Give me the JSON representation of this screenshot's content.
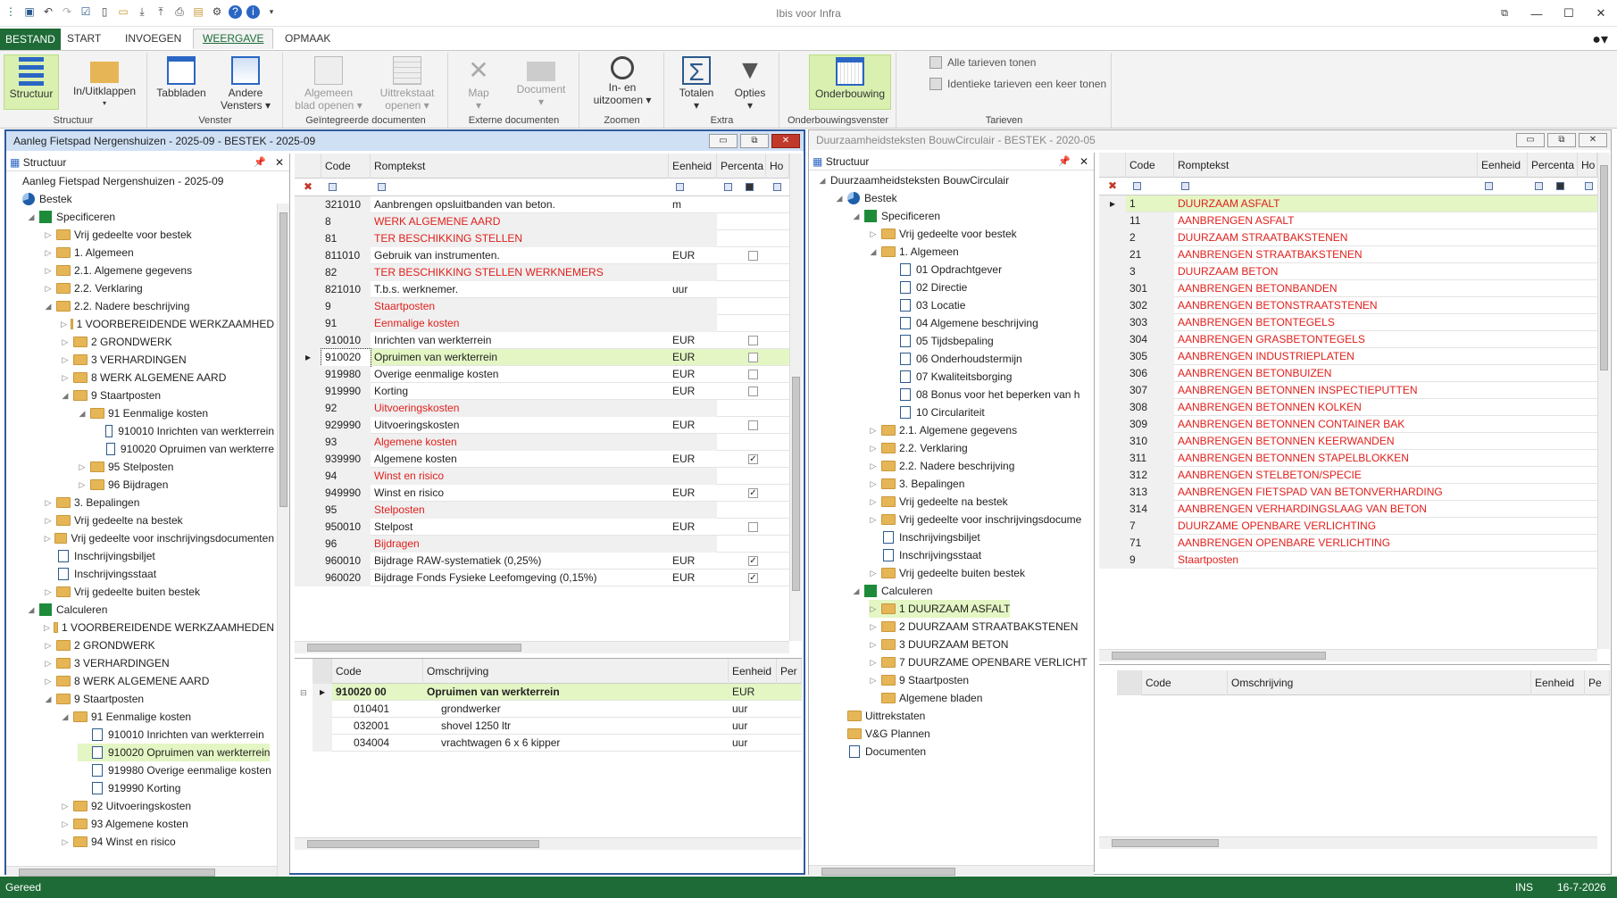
{
  "app": {
    "title": "Ibis voor Infra"
  },
  "ribbon_tabs": [
    "BESTAND",
    "START",
    "INVOEGEN",
    "WEERGAVE",
    "OPMAAK"
  ],
  "ribbon": {
    "structuur": "Structuur",
    "inuitklappen": "In/Uitklappen",
    "tabbladen": "Tabbladen",
    "andere1": "Andere",
    "andere2": "Vensters",
    "alg1": "Algemeen",
    "alg2": "blad openen",
    "uit1": "Uittrekstaat",
    "uit2": "openen",
    "map": "Map",
    "document": "Document",
    "zoom1": "In- en",
    "zoom2": "uitzoomen",
    "totalen": "Totalen",
    "opties": "Opties",
    "onderbouwing": "Onderbouwing",
    "alle": "Alle tarieven tonen",
    "identiek": "Identieke tarieven een keer tonen",
    "groups": {
      "structuur": "Structuur",
      "venster": "Venster",
      "geint": "Geïntegreerde documenten",
      "extern": "Externe documenten",
      "zoomen": "Zoomen",
      "extra": "Extra",
      "ondervenster": "Onderbouwingsvenster",
      "tarieven": "Tarieven"
    }
  },
  "left_pane": {
    "title": "Aanleg Fietspad Nergenshuizen - 2025-09 - BESTEK - 2025-09",
    "tree_header": "Structuur",
    "tree": [
      {
        "l": 0,
        "t": "Aanleg Fietspad Nergenshuizen - 2025-09",
        "i": "none",
        "tog": ""
      },
      {
        "l": 0,
        "t": "Bestek",
        "i": "pie",
        "tog": ""
      },
      {
        "l": 1,
        "t": "Specificeren",
        "i": "grn",
        "tog": "◢"
      },
      {
        "l": 2,
        "t": "Vrij gedeelte voor bestek",
        "i": "fold",
        "tog": "▷"
      },
      {
        "l": 2,
        "t": "1. Algemeen",
        "i": "fold",
        "tog": "▷"
      },
      {
        "l": 2,
        "t": "2.1. Algemene gegevens",
        "i": "fold",
        "tog": "▷"
      },
      {
        "l": 2,
        "t": "2.2. Verklaring",
        "i": "fold",
        "tog": "▷"
      },
      {
        "l": 2,
        "t": "2.2. Nadere beschrijving",
        "i": "fold",
        "tog": "◢"
      },
      {
        "l": 3,
        "t": "1   VOORBEREIDENDE WERKZAAMHED",
        "i": "fold",
        "tog": "▷"
      },
      {
        "l": 3,
        "t": "2   GRONDWERK",
        "i": "fold",
        "tog": "▷"
      },
      {
        "l": 3,
        "t": "3   VERHARDINGEN",
        "i": "fold",
        "tog": "▷"
      },
      {
        "l": 3,
        "t": "8   WERK ALGEMENE AARD",
        "i": "fold",
        "tog": "▷"
      },
      {
        "l": 3,
        "t": "9   Staartposten",
        "i": "fold",
        "tog": "◢"
      },
      {
        "l": 4,
        "t": "91   Eenmalige kosten",
        "i": "fold",
        "tog": "◢"
      },
      {
        "l": 5,
        "t": "910010   Inrichten van werkterrein",
        "i": "doc",
        "tog": ""
      },
      {
        "l": 5,
        "t": "910020   Opruimen van werkterre",
        "i": "doc",
        "tog": ""
      },
      {
        "l": 4,
        "t": "95   Stelposten",
        "i": "fold",
        "tog": "▷"
      },
      {
        "l": 4,
        "t": "96   Bijdragen",
        "i": "fold",
        "tog": "▷"
      },
      {
        "l": 2,
        "t": "3. Bepalingen",
        "i": "fold",
        "tog": "▷"
      },
      {
        "l": 2,
        "t": "Vrij gedeelte na bestek",
        "i": "fold",
        "tog": "▷"
      },
      {
        "l": 2,
        "t": "Vrij gedeelte voor inschrijvingsdocumenten",
        "i": "fold",
        "tog": "▷"
      },
      {
        "l": 2,
        "t": "Inschrijvingsbiljet",
        "i": "doc",
        "tog": ""
      },
      {
        "l": 2,
        "t": "Inschrijvingsstaat",
        "i": "doc",
        "tog": ""
      },
      {
        "l": 2,
        "t": "Vrij gedeelte buiten bestek",
        "i": "fold",
        "tog": "▷"
      },
      {
        "l": 1,
        "t": "Calculeren",
        "i": "grn",
        "tog": "◢"
      },
      {
        "l": 2,
        "t": "1   VOORBEREIDENDE WERKZAAMHEDEN",
        "i": "fold",
        "tog": "▷"
      },
      {
        "l": 2,
        "t": "2   GRONDWERK",
        "i": "fold",
        "tog": "▷"
      },
      {
        "l": 2,
        "t": "3   VERHARDINGEN",
        "i": "fold",
        "tog": "▷"
      },
      {
        "l": 2,
        "t": "8   WERK ALGEMENE AARD",
        "i": "fold",
        "tog": "▷"
      },
      {
        "l": 2,
        "t": "9   Staartposten",
        "i": "fold",
        "tog": "◢"
      },
      {
        "l": 3,
        "t": "91   Eenmalige kosten",
        "i": "fold",
        "tog": "◢"
      },
      {
        "l": 4,
        "t": "910010   Inrichten van werkterrein",
        "i": "doc",
        "tog": ""
      },
      {
        "l": 4,
        "t": "910020   Opruimen van werkterrein",
        "i": "doc",
        "tog": "",
        "sel": true
      },
      {
        "l": 4,
        "t": "919980   Overige eenmalige kosten",
        "i": "doc",
        "tog": ""
      },
      {
        "l": 4,
        "t": "919990   Korting",
        "i": "doc",
        "tog": ""
      },
      {
        "l": 3,
        "t": "92   Uitvoeringskosten",
        "i": "fold",
        "tog": "▷"
      },
      {
        "l": 3,
        "t": "93   Algemene kosten",
        "i": "fold",
        "tog": "▷"
      },
      {
        "l": 3,
        "t": "94   Winst en risico",
        "i": "fold",
        "tog": "▷"
      }
    ],
    "grid_headers": [
      "Code",
      "Romptekst",
      "Eenheid",
      "Percenta",
      "Ho"
    ],
    "grid": [
      {
        "c": "321010",
        "t": "Aanbrengen opsluitbanden van beton.",
        "e": "m",
        "cb": "",
        "red": false,
        "gray": false
      },
      {
        "c": "8",
        "t": "WERK ALGEMENE AARD",
        "e": "",
        "cb": "",
        "red": true,
        "gray": true
      },
      {
        "c": "81",
        "t": "TER BESCHIKKING STELLEN",
        "e": "",
        "cb": "",
        "red": true,
        "gray": true
      },
      {
        "c": "811010",
        "t": "Gebruik van instrumenten.",
        "e": "EUR",
        "cb": "o",
        "red": false,
        "gray": false
      },
      {
        "c": "82",
        "t": "TER BESCHIKKING STELLEN WERKNEMERS",
        "e": "",
        "cb": "",
        "red": true,
        "gray": true
      },
      {
        "c": "821010",
        "t": "T.b.s. werknemer.",
        "e": "uur",
        "cb": "",
        "red": false,
        "gray": false
      },
      {
        "c": "9",
        "t": "Staartposten",
        "e": "",
        "cb": "",
        "red": true,
        "gray": true
      },
      {
        "c": "91",
        "t": "Eenmalige kosten",
        "e": "",
        "cb": "",
        "red": true,
        "gray": true
      },
      {
        "c": "910010",
        "t": "Inrichten van werkterrein",
        "e": "EUR",
        "cb": "o",
        "red": false,
        "gray": false
      },
      {
        "c": "910020",
        "t": "Opruimen van werkterrein",
        "e": "EUR",
        "cb": "o",
        "red": false,
        "gray": false,
        "sel": true
      },
      {
        "c": "919980",
        "t": "Overige eenmalige kosten",
        "e": "EUR",
        "cb": "o",
        "red": false,
        "gray": false
      },
      {
        "c": "919990",
        "t": "Korting",
        "e": "EUR",
        "cb": "o",
        "red": false,
        "gray": false
      },
      {
        "c": "92",
        "t": "Uitvoeringskosten",
        "e": "",
        "cb": "",
        "red": true,
        "gray": true
      },
      {
        "c": "929990",
        "t": "Uitvoeringskosten",
        "e": "EUR",
        "cb": "o",
        "red": false,
        "gray": false
      },
      {
        "c": "93",
        "t": "Algemene kosten",
        "e": "",
        "cb": "",
        "red": true,
        "gray": true
      },
      {
        "c": "939990",
        "t": "Algemene kosten",
        "e": "EUR",
        "cb": "x",
        "red": false,
        "gray": false
      },
      {
        "c": "94",
        "t": "Winst en risico",
        "e": "",
        "cb": "",
        "red": true,
        "gray": true
      },
      {
        "c": "949990",
        "t": "Winst en risico",
        "e": "EUR",
        "cb": "x",
        "red": false,
        "gray": false
      },
      {
        "c": "95",
        "t": "Stelposten",
        "e": "",
        "cb": "",
        "red": true,
        "gray": true
      },
      {
        "c": "950010",
        "t": "Stelpost",
        "e": "EUR",
        "cb": "o",
        "red": false,
        "gray": false
      },
      {
        "c": "96",
        "t": "Bijdragen",
        "e": "",
        "cb": "",
        "red": true,
        "gray": true
      },
      {
        "c": "960010",
        "t": "Bijdrage RAW-systematiek (0,25%)",
        "e": "EUR",
        "cb": "x",
        "red": false,
        "gray": false
      },
      {
        "c": "960020",
        "t": "Bijdrage Fonds Fysieke Leefomgeving (0,15%)",
        "e": "EUR",
        "cb": "x",
        "red": false,
        "gray": false
      }
    ],
    "sub_headers": [
      "Code",
      "Omschrijving",
      "Eenheid",
      "Per"
    ],
    "sub_rows": [
      {
        "c": "910020 00",
        "t": "Opruimen van werkterrein",
        "e": "EUR",
        "bold": true
      },
      {
        "c": "010401",
        "t": "grondwerker",
        "e": "uur",
        "bold": false
      },
      {
        "c": "032001",
        "t": "shovel 1250 ltr",
        "e": "uur",
        "bold": false
      },
      {
        "c": "034004",
        "t": "vrachtwagen 6 x 6  kipper",
        "e": "uur",
        "bold": false
      }
    ]
  },
  "right_pane": {
    "title": "Duurzaamheidsteksten BouwCirculair - BESTEK - 2020-05",
    "tree_header": "Structuur",
    "tree": [
      {
        "l": 0,
        "t": "Duurzaamheidsteksten BouwCirculair",
        "i": "none",
        "tog": "◢"
      },
      {
        "l": 1,
        "t": "Bestek",
        "i": "pie",
        "tog": "◢"
      },
      {
        "l": 2,
        "t": "Specificeren",
        "i": "grn",
        "tog": "◢"
      },
      {
        "l": 3,
        "t": "Vrij gedeelte voor bestek",
        "i": "fold",
        "tog": "▷"
      },
      {
        "l": 3,
        "t": "1. Algemeen",
        "i": "fold",
        "tog": "◢"
      },
      {
        "l": 4,
        "t": "01   Opdrachtgever",
        "i": "doc",
        "tog": ""
      },
      {
        "l": 4,
        "t": "02   Directie",
        "i": "doc",
        "tog": ""
      },
      {
        "l": 4,
        "t": "03   Locatie",
        "i": "doc",
        "tog": ""
      },
      {
        "l": 4,
        "t": "04   Algemene beschrijving",
        "i": "doc",
        "tog": ""
      },
      {
        "l": 4,
        "t": "05   Tijdsbepaling",
        "i": "doc",
        "tog": ""
      },
      {
        "l": 4,
        "t": "06   Onderhoudstermijn",
        "i": "doc",
        "tog": ""
      },
      {
        "l": 4,
        "t": "07   Kwaliteitsborging",
        "i": "doc",
        "tog": ""
      },
      {
        "l": 4,
        "t": "08   Bonus voor het beperken van h",
        "i": "doc",
        "tog": ""
      },
      {
        "l": 4,
        "t": "10   Circulariteit",
        "i": "doc",
        "tog": ""
      },
      {
        "l": 3,
        "t": "2.1. Algemene gegevens",
        "i": "fold",
        "tog": "▷"
      },
      {
        "l": 3,
        "t": "2.2. Verklaring",
        "i": "fold",
        "tog": "▷"
      },
      {
        "l": 3,
        "t": "2.2. Nadere beschrijving",
        "i": "fold",
        "tog": "▷"
      },
      {
        "l": 3,
        "t": "3. Bepalingen",
        "i": "fold",
        "tog": "▷"
      },
      {
        "l": 3,
        "t": "Vrij gedeelte na bestek",
        "i": "fold",
        "tog": "▷"
      },
      {
        "l": 3,
        "t": "Vrij gedeelte voor inschrijvingsdocume",
        "i": "fold",
        "tog": "▷"
      },
      {
        "l": 3,
        "t": "Inschrijvingsbiljet",
        "i": "doc",
        "tog": ""
      },
      {
        "l": 3,
        "t": "Inschrijvingsstaat",
        "i": "doc",
        "tog": ""
      },
      {
        "l": 3,
        "t": "Vrij gedeelte buiten bestek",
        "i": "fold",
        "tog": "▷"
      },
      {
        "l": 2,
        "t": "Calculeren",
        "i": "grn",
        "tog": "◢"
      },
      {
        "l": 3,
        "t": "1   DUURZAAM ASFALT",
        "i": "fold",
        "tog": "▷",
        "sel": true
      },
      {
        "l": 3,
        "t": "2   DUURZAAM STRAATBAKSTENEN",
        "i": "fold",
        "tog": "▷"
      },
      {
        "l": 3,
        "t": "3   DUURZAAM BETON",
        "i": "fold",
        "tog": "▷"
      },
      {
        "l": 3,
        "t": "7   DUURZAME OPENBARE VERLICHT",
        "i": "fold",
        "tog": "▷"
      },
      {
        "l": 3,
        "t": "9   Staartposten",
        "i": "fold",
        "tog": "▷"
      },
      {
        "l": 3,
        "t": "Algemene bladen",
        "i": "fold",
        "tog": ""
      },
      {
        "l": 1,
        "t": "Uittrekstaten",
        "i": "fold",
        "tog": ""
      },
      {
        "l": 1,
        "t": "V&G Plannen",
        "i": "fold",
        "tog": ""
      },
      {
        "l": 1,
        "t": "Documenten",
        "i": "doc",
        "tog": ""
      }
    ],
    "grid_headers": [
      "Code",
      "Romptekst",
      "Eenheid",
      "Percenta",
      "Ho"
    ],
    "grid": [
      {
        "c": "1",
        "t": "DUURZAAM ASFALT",
        "sel": true
      },
      {
        "c": "11",
        "t": "AANBRENGEN ASFALT"
      },
      {
        "c": "2",
        "t": "DUURZAAM STRAATBAKSTENEN"
      },
      {
        "c": "21",
        "t": "AANBRENGEN STRAATBAKSTENEN"
      },
      {
        "c": "3",
        "t": "DUURZAAM BETON"
      },
      {
        "c": "301",
        "t": "AANBRENGEN BETONBANDEN"
      },
      {
        "c": "302",
        "t": "AANBRENGEN BETONSTRAATSTENEN"
      },
      {
        "c": "303",
        "t": "AANBRENGEN BETONTEGELS"
      },
      {
        "c": "304",
        "t": "AANBRENGEN GRASBETONTEGELS"
      },
      {
        "c": "305",
        "t": "AANBRENGEN INDUSTRIEPLATEN"
      },
      {
        "c": "306",
        "t": "AANBRENGEN BETONBUIZEN"
      },
      {
        "c": "307",
        "t": "AANBRENGEN BETONNEN INSPECTIEPUTTEN"
      },
      {
        "c": "308",
        "t": "AANBRENGEN BETONNEN KOLKEN"
      },
      {
        "c": "309",
        "t": "AANBRENGEN BETONNEN CONTAINER BAK"
      },
      {
        "c": "310",
        "t": "AANBRENGEN BETONNEN KEERWANDEN"
      },
      {
        "c": "311",
        "t": "AANBRENGEN BETONNEN STAPELBLOKKEN"
      },
      {
        "c": "312",
        "t": "AANBRENGEN STELBETON/SPECIE"
      },
      {
        "c": "313",
        "t": "AANBRENGEN FIETSPAD VAN BETONVERHARDING"
      },
      {
        "c": "314",
        "t": "AANBRENGEN VERHARDINGSLAAG VAN BETON"
      },
      {
        "c": "7",
        "t": "DUURZAME OPENBARE VERLICHTING"
      },
      {
        "c": "71",
        "t": "AANBRENGEN OPENBARE VERLICHTING"
      },
      {
        "c": "9",
        "t": "Staartposten"
      }
    ],
    "sub_headers": [
      "Code",
      "Omschrijving",
      "Eenheid",
      "Pe"
    ]
  },
  "status": {
    "left": "Gereed",
    "ins": "INS",
    "date": "16-7-2026"
  }
}
